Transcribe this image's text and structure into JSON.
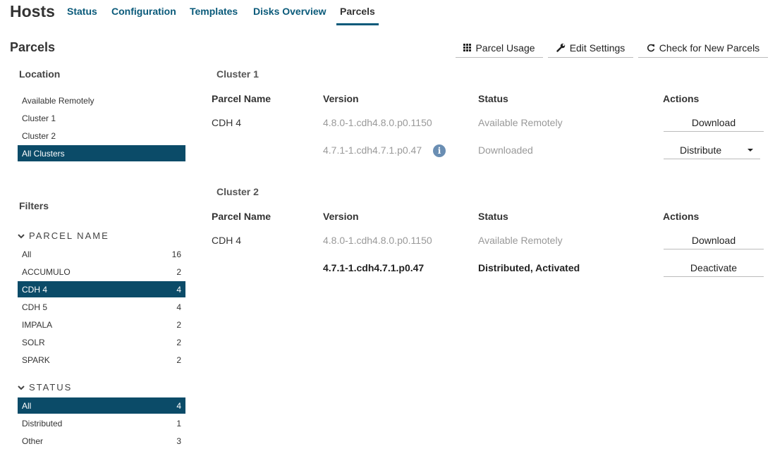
{
  "header": {
    "title": "Hosts",
    "tabs": [
      {
        "label": "Status"
      },
      {
        "label": "Configuration"
      },
      {
        "label": "Templates"
      },
      {
        "label": "Disks Overview"
      },
      {
        "label": "Parcels"
      }
    ],
    "active_tab": "Parcels"
  },
  "page": {
    "section_title": "Parcels",
    "buttons": {
      "parcel_usage": "Parcel Usage",
      "edit_settings": "Edit Settings",
      "check_new": "Check for New Parcels"
    }
  },
  "sidebar": {
    "location_heading": "Location",
    "locations": [
      {
        "label": "Available Remotely"
      },
      {
        "label": "Cluster 1"
      },
      {
        "label": "Cluster 2"
      },
      {
        "label": "All Clusters",
        "selected": true
      }
    ],
    "filters_heading": "Filters",
    "parcel_name_group": "PARCEL NAME",
    "parcel_names": [
      {
        "label": "All",
        "count": "16"
      },
      {
        "label": "ACCUMULO",
        "count": "2"
      },
      {
        "label": "CDH 4",
        "count": "4",
        "selected": true
      },
      {
        "label": "CDH 5",
        "count": "4"
      },
      {
        "label": "IMPALA",
        "count": "2"
      },
      {
        "label": "SOLR",
        "count": "2"
      },
      {
        "label": "SPARK",
        "count": "2"
      }
    ],
    "status_group": "STATUS",
    "statuses": [
      {
        "label": "All",
        "count": "4",
        "selected": true
      },
      {
        "label": "Distributed",
        "count": "1"
      },
      {
        "label": "Other",
        "count": "3"
      }
    ]
  },
  "columns": {
    "name": "Parcel Name",
    "version": "Version",
    "status": "Status",
    "actions": "Actions"
  },
  "clusters": [
    {
      "title": "Cluster 1",
      "rows": [
        {
          "name": "CDH 4",
          "version": "4.8.0-1.cdh4.8.0.p0.1150",
          "status": "Available Remotely",
          "action": "Download"
        },
        {
          "name": "",
          "version": "4.7.1-1.cdh4.7.1.p0.47",
          "status": "Downloaded",
          "action": "Distribute"
        }
      ]
    },
    {
      "title": "Cluster 2",
      "rows": [
        {
          "name": "CDH 4",
          "version": "4.8.0-1.cdh4.8.0.p0.1150",
          "status": "Available Remotely",
          "action": "Download"
        },
        {
          "name": "",
          "version": "4.7.1-1.cdh4.7.1.p0.47",
          "status": "Distributed, Activated",
          "action": "Deactivate"
        }
      ]
    }
  ],
  "icons": {
    "info": "i",
    "accent_color": "#0b4b68",
    "link_color": "#0a5a7a"
  }
}
